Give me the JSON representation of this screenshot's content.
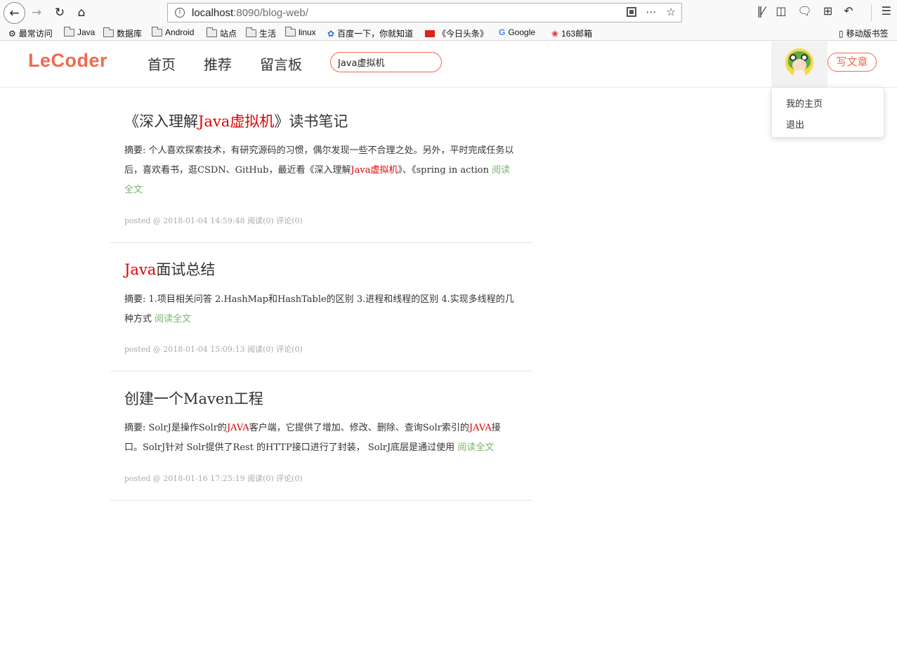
{
  "browser": {
    "url_host": "localhost",
    "url_path": ":8090/blog-web/",
    "bookmarks": [
      {
        "label": "最常访问",
        "icon": "gear-icon"
      },
      {
        "label": "Java",
        "icon": "folder-icon"
      },
      {
        "label": "数据库",
        "icon": "folder-icon"
      },
      {
        "label": "Android",
        "icon": "folder-icon"
      },
      {
        "label": "站点",
        "icon": "folder-icon"
      },
      {
        "label": "生活",
        "icon": "folder-icon"
      },
      {
        "label": "linux",
        "icon": "folder-icon"
      },
      {
        "label": "百度一下，你就知道",
        "icon": "baidu-paw-icon"
      },
      {
        "label": "《今日头条》",
        "icon": "toutiao-icon"
      },
      {
        "label": "Google",
        "icon": "google-icon"
      },
      {
        "label": "163邮箱",
        "icon": "mail163-icon"
      }
    ],
    "mobile_bookmarks": "移动版书签"
  },
  "site": {
    "logo": "LeCoder",
    "nav": [
      "首页",
      "推荐",
      "留言板"
    ],
    "search_value": "Java虚拟机",
    "write_button": "写文章",
    "user_menu": [
      "我的主页",
      "退出"
    ],
    "accent_color": "#ee6a50",
    "highlight_color": "#e00000",
    "link_color": "#7cb46b"
  },
  "articles": [
    {
      "title_pre": "《深入理解",
      "title_hl": "Java虚拟机",
      "title_post": "》读书笔记",
      "summary_1": "摘要: 个人喜欢探索技术，有研究源码的习惯，偶尔发现一些不合理之处。另外，平时完成任务以后，喜欢看书，逛CSDN、GitHub，最近看《深入理解",
      "summary_hl": "Java虚拟机",
      "summary_2": "》、《spring in action",
      "read_more": "阅读全文",
      "meta": "posted @ 2018-01-04 14:59:48 阅读(0) 评论(0)"
    },
    {
      "title_hl": "Java",
      "title_post": "面试总结",
      "summary_1": "摘要: 1.项目相关问答 2.HashMap和HashTable的区别 3.进程和线程的区别 4.实现多线程的几种方式",
      "read_more": "阅读全文",
      "meta": "posted @ 2018-01-04 15:09:13 阅读(0) 评论(0)"
    },
    {
      "title_post": "创建一个Maven工程",
      "summary_1": "摘要: SolrJ是操作Solr的",
      "summary_hl": "JAVA",
      "summary_2": "客户端，它提供了增加、修改、删除、查询Solr索引的",
      "summary_hl2": "JAVA",
      "summary_3": "接口。SolrJ针对 Solr提供了Rest 的HTTP接口进行了封装， SolrJ底层是通过使用",
      "read_more": "阅读全文",
      "meta": "posted @ 2018-01-16 17:25:19 阅读(0) 评论(0)"
    }
  ]
}
